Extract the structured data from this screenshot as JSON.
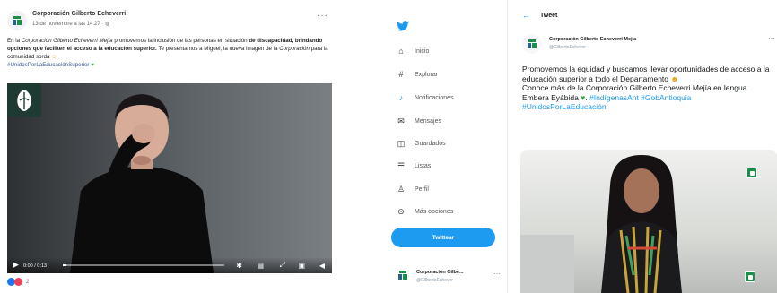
{
  "colors": {
    "twitter_blue": "#1d9bf0",
    "facebook_link": "#385898",
    "brand_green": "#1a8f4a"
  },
  "facebook": {
    "page_name": "Corporación Gilberto Echeverri",
    "timestamp": "13 de noviembre a las 14:27 · ",
    "post": {
      "intro_text": "En la ",
      "intro_italic": "Corporación Gilberto Echeverri Mejía",
      "intro_rest": " promovemos la inclusión de las personas en situación",
      "bold_text": "de discapacidad, brindando opciones que faciliten el acceso a la educación superior.",
      "rest_text": " Te presentamos a Miguel, la nueva imagen de la ",
      "rest_italic": "Corporación",
      "rest_tail": " para la comunidad sorda ",
      "hashtags": "#UnidosPorLaEducaciónSuperior"
    },
    "video": {
      "timecode": "0:00 / 0:13",
      "progress_percent": 2
    },
    "reactions_count": "2"
  },
  "twitter": {
    "nav_items": [
      {
        "label": "Inicio",
        "icon": "home-icon"
      },
      {
        "label": "Explorar",
        "icon": "hashtag-icon"
      },
      {
        "label": "Notificaciones",
        "icon": "bell-icon"
      },
      {
        "label": "Mensajes",
        "icon": "mail-icon"
      },
      {
        "label": "Guardados",
        "icon": "bookmark-icon"
      },
      {
        "label": "Listas",
        "icon": "list-icon"
      },
      {
        "label": "Perfil",
        "icon": "person-icon"
      },
      {
        "label": "Más opciones",
        "icon": "more-icon"
      }
    ],
    "tweet_button": "Twittear",
    "account": {
      "name": "Corporación Gilbe...",
      "handle": "@GilbertoEchever"
    },
    "header_title": "Tweet",
    "author": {
      "name": "Corporación Gilberto Echeverri Mejía",
      "handle": "@GilbertoEchever"
    },
    "tweet": {
      "line1": "Promovemos la equidad y buscamos llevar oportunidades de acceso a la educación superior a todo el Departamento ",
      "line2": "Conoce más de la Corporación Gilberto Echeverri Mejía en lengua Embera Eyábida ",
      "tags": "#IndígenasAnt #GobAntioquia #UnidosPorLaEducación"
    }
  }
}
